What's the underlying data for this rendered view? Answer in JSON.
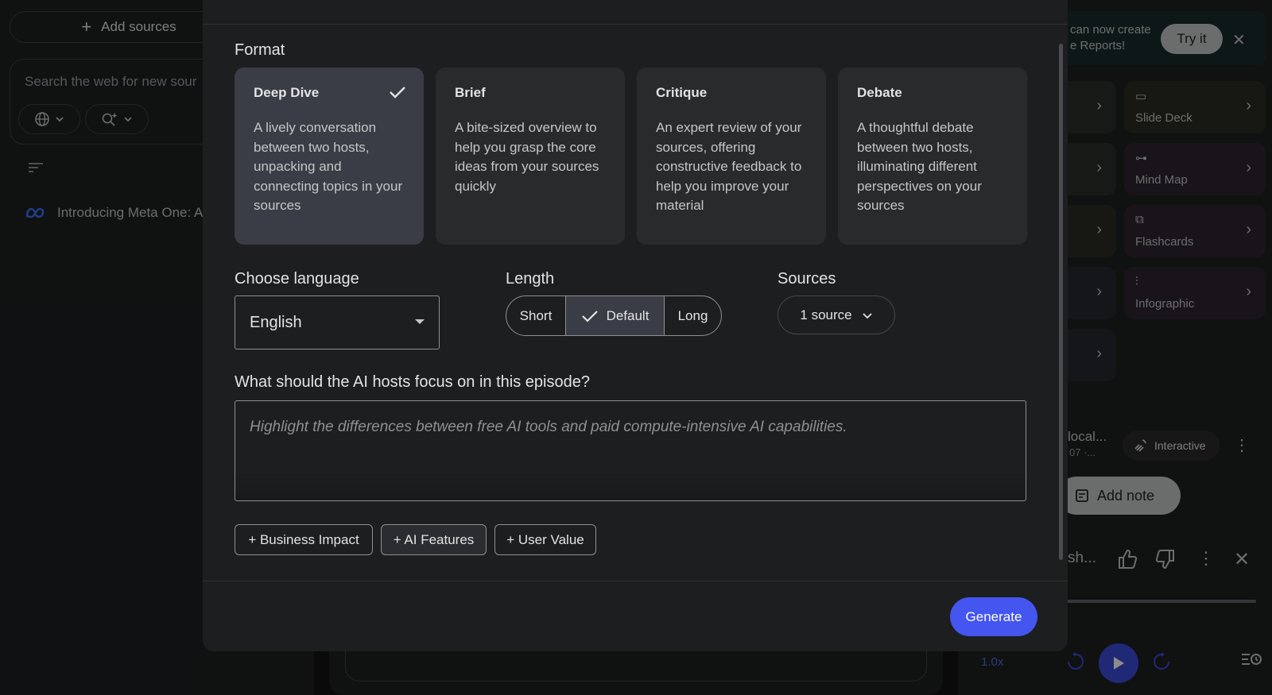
{
  "left_panel": {
    "add_sources_label": "Add sources",
    "search_placeholder": "Search the web for new sour",
    "source_item": "Introducing Meta One: A"
  },
  "right_panel": {
    "banner_text_line1": "can now create",
    "banner_text_line2": "e Reports!",
    "try_it_label": "Try it",
    "tiles_left_labels": [
      "/",
      "/",
      "",
      "",
      ""
    ],
    "tiles": [
      {
        "label": "Slide Deck",
        "icon": "slide-deck-icon"
      },
      {
        "label": "Mind Map",
        "icon": "mind-map-icon"
      },
      {
        "label": "Flashcards",
        "icon": "flashcards-icon"
      },
      {
        "label": "Infographic",
        "icon": "infographic-icon"
      }
    ],
    "artifact_title": "local...",
    "artifact_sub": "07 ·...",
    "interactive_label": "Interactive",
    "add_note_label": "Add note",
    "player_title": "sh...",
    "speed_label": "1.0x"
  },
  "modal": {
    "format_heading": "Format",
    "formats": [
      {
        "title": "Deep Dive",
        "desc": "A lively conversation between two hosts, unpacking and connecting topics in your sources",
        "selected": true
      },
      {
        "title": "Brief",
        "desc": "A bite-sized overview to help you grasp the core ideas from your sources quickly",
        "selected": false
      },
      {
        "title": "Critique",
        "desc": "An expert review of your sources, offering constructive feedback to help you improve your material",
        "selected": false
      },
      {
        "title": "Debate",
        "desc": "A thoughtful debate between two hosts, illuminating different perspectives on your sources",
        "selected": false
      }
    ],
    "language_heading": "Choose language",
    "language_value": "English",
    "length_heading": "Length",
    "length_options": {
      "short": "Short",
      "default": "Default",
      "long": "Long"
    },
    "length_selected": "Default",
    "sources_heading": "Sources",
    "sources_value": "1 source",
    "focus_question": "What should the AI hosts focus on in this episode?",
    "focus_placeholder": "Highlight the differences between free AI tools and paid compute-intensive AI capabilities.",
    "suggestions": [
      "+ Business Impact",
      "+ AI Features",
      "+ User Value"
    ],
    "generate_label": "Generate"
  },
  "colors": {
    "accent": "#4455f0",
    "modal_bg": "#1d1e20",
    "card_bg": "#282a2c",
    "card_selected_bg": "#3a3d46"
  }
}
